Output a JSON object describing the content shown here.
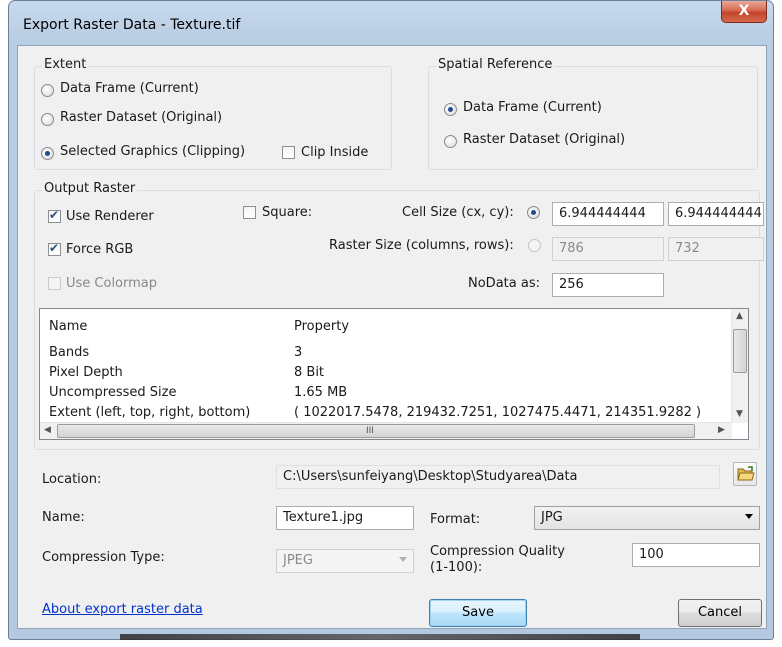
{
  "window": {
    "title": "Export Raster Data - Texture.tif",
    "close_glyph": "X"
  },
  "extent": {
    "label": "Extent",
    "options": [
      "Data Frame (Current)",
      "Raster Dataset (Original)",
      "Selected Graphics (Clipping)"
    ],
    "selected_index": 2,
    "clip_inside_label": "Clip Inside",
    "clip_inside_checked": false
  },
  "spatial_reference": {
    "label": "Spatial Reference",
    "options": [
      "Data Frame (Current)",
      "Raster Dataset (Original)"
    ],
    "selected_index": 0
  },
  "output_raster": {
    "label": "Output Raster",
    "use_renderer": {
      "label": "Use Renderer",
      "checked": true
    },
    "force_rgb": {
      "label": "Force RGB",
      "checked": true
    },
    "use_colormap": {
      "label": "Use Colormap",
      "checked": false,
      "enabled": false
    },
    "square": {
      "label": "Square:",
      "checked": false
    },
    "cell_size": {
      "label": "Cell Size (cx, cy):",
      "selected": true,
      "cx": "6.944444444",
      "cy": "6.944444444"
    },
    "raster_size": {
      "label": "Raster Size (columns, rows):",
      "selected": false,
      "columns": "786",
      "rows": "732"
    },
    "nodata": {
      "label": "NoData as:",
      "value": "256"
    }
  },
  "properties": {
    "headers": [
      "Name",
      "Property"
    ],
    "rows": [
      {
        "name": "Bands",
        "value": "3"
      },
      {
        "name": "Pixel Depth",
        "value": "8 Bit"
      },
      {
        "name": "Uncompressed Size",
        "value": "1.65 MB"
      },
      {
        "name": "Extent (left, top, right, bottom)",
        "value": "( 1022017.5478, 219432.7251, 1027475.4471, 214351.9282 )"
      }
    ],
    "hscroll_grip": "III"
  },
  "location": {
    "label": "Location:",
    "value": "C:\\Users\\sunfeiyang\\Desktop\\Studyarea\\Data"
  },
  "name": {
    "label": "Name:",
    "value": "Texture1.jpg"
  },
  "format": {
    "label": "Format:",
    "value": "JPG"
  },
  "compression_type": {
    "label": "Compression Type:",
    "value": "JPEG"
  },
  "compression_quality": {
    "label_line1": "Compression Quality",
    "label_line2": "(1-100):",
    "value": "100"
  },
  "footer": {
    "help_link": "About export raster data",
    "save_label": "Save",
    "cancel_label": "Cancel"
  },
  "colors": {
    "title_bar": "#b9cde3",
    "close_button": "#c2432a",
    "link": "#0033cc",
    "default_button": "#3c7fb1"
  }
}
